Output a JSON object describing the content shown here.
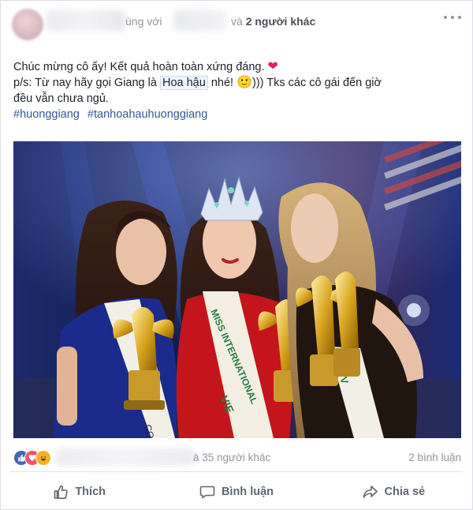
{
  "header": {
    "with_text": "ùng với",
    "and_text": "và",
    "others_link": "2 người khác"
  },
  "post": {
    "line1": "Chúc mừng cô ấy! Kết quả hoàn toàn xứng đáng.",
    "heart_glyph": "❤",
    "line2_prefix": "p/s: Từ nay hãy gọi Giang là",
    "line2_highlight": "Hoa hậu",
    "line2_mid": "nhé!",
    "smiley_glyph": "🙂",
    "line2_suffix": "))) Tks các cô gái đến giờ",
    "line3": "đều vẫn chưa ngủ.",
    "hashtags": [
      "#huonggiang",
      "#tanhoahauhuonggiang"
    ]
  },
  "photo": {
    "sash_text": "MISS INTERNATIONAL",
    "sash_country": "VIE",
    "sash_left_text": "COND",
    "sash_right_text": "V"
  },
  "reactions": {
    "icons": [
      "like-icon",
      "love-icon",
      "haha-icon"
    ],
    "count_text": "à 35 người khác",
    "comments": "2 bình luận"
  },
  "actions": {
    "like": "Thích",
    "comment": "Bình luận",
    "share": "Chia sẻ"
  },
  "colors": {
    "link": "#365899",
    "like_blue": "#4267b2",
    "love_red": "#f25268",
    "haha_yellow": "#f7b125",
    "muted": "#90949c"
  }
}
